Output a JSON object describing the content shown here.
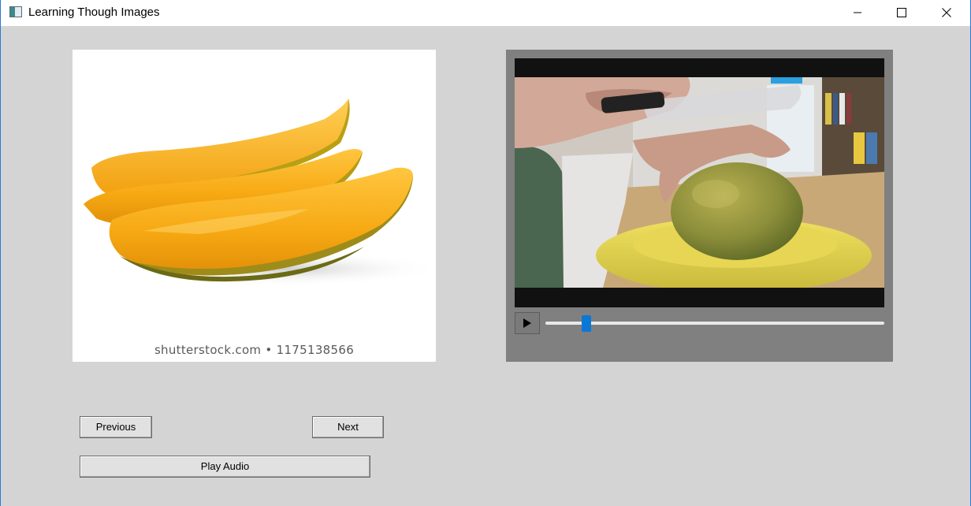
{
  "window": {
    "title": "Learning Though Images",
    "icons": {
      "app": "app-window-icon",
      "minimize": "minimize-icon",
      "maximize": "maximize-icon",
      "close": "close-icon"
    }
  },
  "image_panel": {
    "subject": "sliced mango",
    "watermark": "shutterstock.com • 1175138566"
  },
  "video_player": {
    "subject": "hands cutting a mango on a yellow plate",
    "play_icon": "play-icon",
    "seek_position": 0.11,
    "accent_color": "#0a78d7"
  },
  "buttons": {
    "previous_label": "Previous",
    "next_label": "Next",
    "play_audio_label": "Play Audio"
  },
  "colors": {
    "window_background": "#d4d4d4",
    "video_panel_background": "#808080",
    "seek_thumb": "#0a78d7"
  }
}
